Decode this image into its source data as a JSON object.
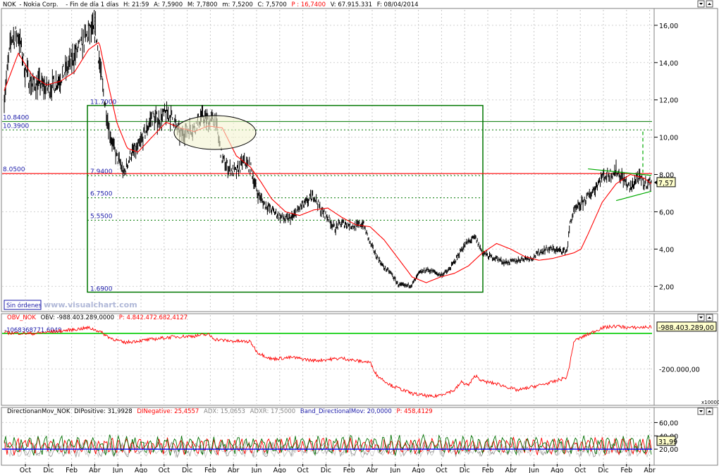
{
  "header": {
    "symbol": "NOK",
    "name": "- Nokia Corp.",
    "period": "- Fin de día 1 días",
    "hour": "H: 21:59",
    "open": "A: 7,5900",
    "high": "M: 7,7800",
    "low": "m: 7,5200",
    "close": "C: 7,5700",
    "perf": "P : 16,7400",
    "volume": "V: 67.915.331",
    "date": "F: 08/04/2014"
  },
  "badges": {
    "sin_ordenes": "Sin órdenes",
    "watermark": "www.visualchart.com"
  },
  "obv_header": {
    "name": "OBV_NOK",
    "value": "OBV: -988.403.289,0000",
    "perf": "P: 4.842.472.682,4127",
    "level_label": "-1068368771.6049",
    "last_label": "-988.403.289,00",
    "scale_label": "x10000"
  },
  "dmi_header": {
    "name": "DirectionanMov_NOK",
    "dip": "DIPositive: 31,9928",
    "din": "DINegative: 25,4557",
    "adx": "ADX: 15,0653",
    "adxr": "ADXR: 17,5000",
    "band": "Band_DirectionalMov: 20,0000",
    "perf": "P: 458,4129",
    "last_label": "31,99"
  },
  "colors": {
    "price": "#000000",
    "ma": "#ff0000",
    "obv": "#ff0000",
    "dip": "#007000",
    "din": "#ff0000",
    "adx": "#9a9a9a",
    "adxr": "#c8c8c8",
    "band": "#0000ff",
    "fib_box": "#007700",
    "resistance": "#ff0000",
    "level_text": "#1a1aa8"
  },
  "chart_data": [
    {
      "type": "line",
      "panel": "price",
      "series": [
        {
          "name": "NOK",
          "style": "bar",
          "x": [
            0,
            10,
            20,
            30,
            40,
            50,
            60,
            70,
            80,
            90,
            100,
            110,
            120,
            130,
            140,
            150,
            155,
            160,
            165,
            170,
            180,
            190,
            200,
            210,
            220,
            230,
            240,
            250,
            260,
            270,
            280,
            290,
            300,
            310,
            320,
            330,
            340,
            350,
            360,
            370,
            380,
            390,
            400,
            410,
            420,
            430,
            440,
            450,
            460,
            470,
            480,
            490,
            500,
            510,
            520,
            530,
            540,
            550,
            560,
            570,
            580,
            590,
            600,
            610,
            620,
            630,
            640,
            650,
            660,
            670,
            680,
            690,
            700,
            710,
            720,
            730,
            740,
            750,
            760,
            770,
            780,
            790,
            800,
            805,
            810,
            820,
            830,
            840,
            850,
            860,
            870,
            880,
            890,
            900,
            910,
            920
          ],
          "values": [
            12.2,
            15.3,
            15.5,
            13.6,
            12.8,
            12.9,
            12.6,
            12.8,
            13.2,
            13.7,
            14.4,
            14.9,
            15.6,
            15.7,
            12.6,
            10.3,
            9.5,
            8.9,
            8.6,
            8.0,
            9.1,
            9.4,
            10.2,
            11.1,
            10.9,
            11.3,
            11.0,
            10.1,
            10.4,
            10.5,
            11.1,
            10.9,
            10.9,
            8.8,
            8.3,
            8.1,
            8.7,
            8.4,
            7.0,
            6.4,
            6.1,
            5.8,
            5.6,
            5.7,
            6.2,
            6.5,
            6.9,
            6.1,
            5.7,
            5.1,
            5.4,
            5.3,
            5.2,
            5.4,
            4.3,
            3.6,
            3.0,
            2.7,
            2.1,
            2.0,
            2.1,
            2.7,
            2.9,
            2.8,
            2.6,
            2.8,
            3.3,
            4.0,
            4.4,
            4.6,
            3.8,
            3.6,
            3.5,
            3.3,
            3.3,
            3.4,
            3.5,
            3.5,
            3.8,
            4.0,
            4.0,
            3.9,
            3.9,
            5.5,
            6.0,
            6.4,
            6.8,
            7.3,
            7.9,
            8.0,
            8.2,
            7.8,
            7.2,
            7.9,
            7.5,
            7.6
          ]
        },
        {
          "name": "MA",
          "style": "line",
          "x": [
            0,
            20,
            40,
            60,
            80,
            100,
            120,
            135,
            145,
            160,
            175,
            190,
            210,
            230,
            250,
            270,
            290,
            310,
            330,
            350,
            365,
            380,
            400,
            420,
            440,
            460,
            480,
            500,
            520,
            540,
            560,
            580,
            600,
            620,
            640,
            660,
            680,
            700,
            720,
            740,
            760,
            780,
            800,
            810,
            820,
            830,
            850,
            870,
            890,
            910,
            920
          ],
          "values": [
            12.5,
            14.5,
            13.3,
            12.8,
            13.0,
            13.5,
            14.7,
            15.1,
            13.3,
            10.8,
            9.4,
            9.2,
            10.0,
            10.8,
            10.5,
            10.3,
            10.6,
            10.5,
            9.0,
            8.4,
            7.6,
            6.7,
            6.0,
            5.8,
            6.1,
            6.2,
            5.7,
            5.3,
            5.2,
            4.5,
            3.5,
            2.5,
            2.2,
            2.5,
            2.7,
            3.1,
            3.8,
            4.3,
            4.0,
            3.6,
            3.4,
            3.5,
            3.7,
            3.8,
            4.0,
            4.8,
            6.5,
            7.5,
            8.0,
            7.8,
            7.5
          ]
        }
      ],
      "x_tick_labels": [
        "Oct",
        "Dic",
        "Feb",
        "Abr",
        "Jun",
        "Ago",
        "Oct",
        "Dic",
        "Feb",
        "Abr",
        "Jun",
        "Ago",
        "Oct",
        "Dic",
        "Feb",
        "Abr",
        "Jun",
        "Ago",
        "Oct",
        "Dic",
        "Feb",
        "Abr",
        "Jun",
        "Ago",
        "Oct",
        "Dic",
        "Feb",
        "Abr"
      ],
      "y_ticks": [
        2.0,
        4.0,
        6.0,
        8.0,
        10.0,
        12.0,
        14.0,
        16.0
      ],
      "y_tick_labels": [
        "2,00",
        "4,00",
        "6,00",
        "8,00",
        "10,00",
        "12,00",
        "14,00",
        "16,00"
      ],
      "ylim": [
        0.8,
        16.6
      ],
      "last_label": "7,57",
      "annotations": {
        "fib_high": {
          "label": "11.7000",
          "value": 11.7
        },
        "fib_low": {
          "label": "1.6900",
          "value": 1.69
        },
        "fib_levels": [
          {
            "label": "7.9400",
            "value": 7.94
          },
          {
            "label": "6.7500",
            "value": 6.75
          },
          {
            "label": "5.5500",
            "value": 5.55
          }
        ],
        "left_levels": [
          {
            "label": "10.8400",
            "value": 10.84
          },
          {
            "label": "10.3900",
            "value": 10.39
          },
          {
            "label": "8.0500",
            "value": 8.05
          }
        ]
      }
    },
    {
      "type": "line",
      "panel": "obv",
      "series": [
        {
          "name": "OBV_NOK",
          "x": [
            0,
            40,
            80,
            120,
            135,
            150,
            170,
            200,
            240,
            270,
            290,
            300,
            320,
            350,
            360,
            380,
            410,
            440,
            480,
            500,
            520,
            530,
            550,
            580,
            610,
            640,
            650,
            660,
            670,
            680,
            700,
            730,
            760,
            780,
            800,
            805,
            810,
            830,
            850,
            870,
            890,
            920
          ],
          "values": [
            -106,
            -107,
            -104,
            -100,
            -104,
            -112,
            -118,
            -115,
            -111,
            -110,
            -108,
            -114,
            -116,
            -117,
            -130,
            -138,
            -136,
            -140,
            -137,
            -140,
            -142,
            -158,
            -170,
            -180,
            -184,
            -176,
            -166,
            -170,
            -158,
            -165,
            -168,
            -176,
            -170,
            -166,
            -160,
            -140,
            -116,
            -108,
            -100,
            -98,
            -100,
            -99
          ]
        }
      ],
      "y_tick_labels": [
        "-200.000,00"
      ],
      "level_value": -106.8
    },
    {
      "type": "line",
      "panel": "dmi",
      "series": [
        {
          "name": "DIPositive",
          "x": [],
          "values": []
        },
        {
          "name": "DINegative",
          "x": [],
          "values": []
        },
        {
          "name": "ADX",
          "x": [],
          "values": []
        },
        {
          "name": "ADXR",
          "x": [],
          "values": []
        },
        {
          "name": "Band_DirectionalMov",
          "x": [
            0,
            920
          ],
          "values": [
            20,
            20
          ]
        }
      ],
      "y_ticks": [
        20,
        40,
        60
      ],
      "y_tick_labels": [
        "20,00",
        "40,00",
        "60,00"
      ],
      "ylim": [
        0,
        70
      ]
    }
  ]
}
